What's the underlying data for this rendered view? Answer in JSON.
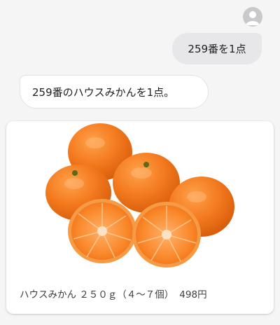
{
  "conversation": {
    "user_message": "259番を1点",
    "assistant_message": "259番のハウスみかんを1点。"
  },
  "product_card": {
    "name": "ハウスみかん ２５０ｇ（４～７個）",
    "price": "498円",
    "image_icon": "mandarin-oranges-photo"
  },
  "colors": {
    "orange": "#f47a1f",
    "background": "#f5f5f6",
    "user_bubble": "#e7e7ea"
  }
}
